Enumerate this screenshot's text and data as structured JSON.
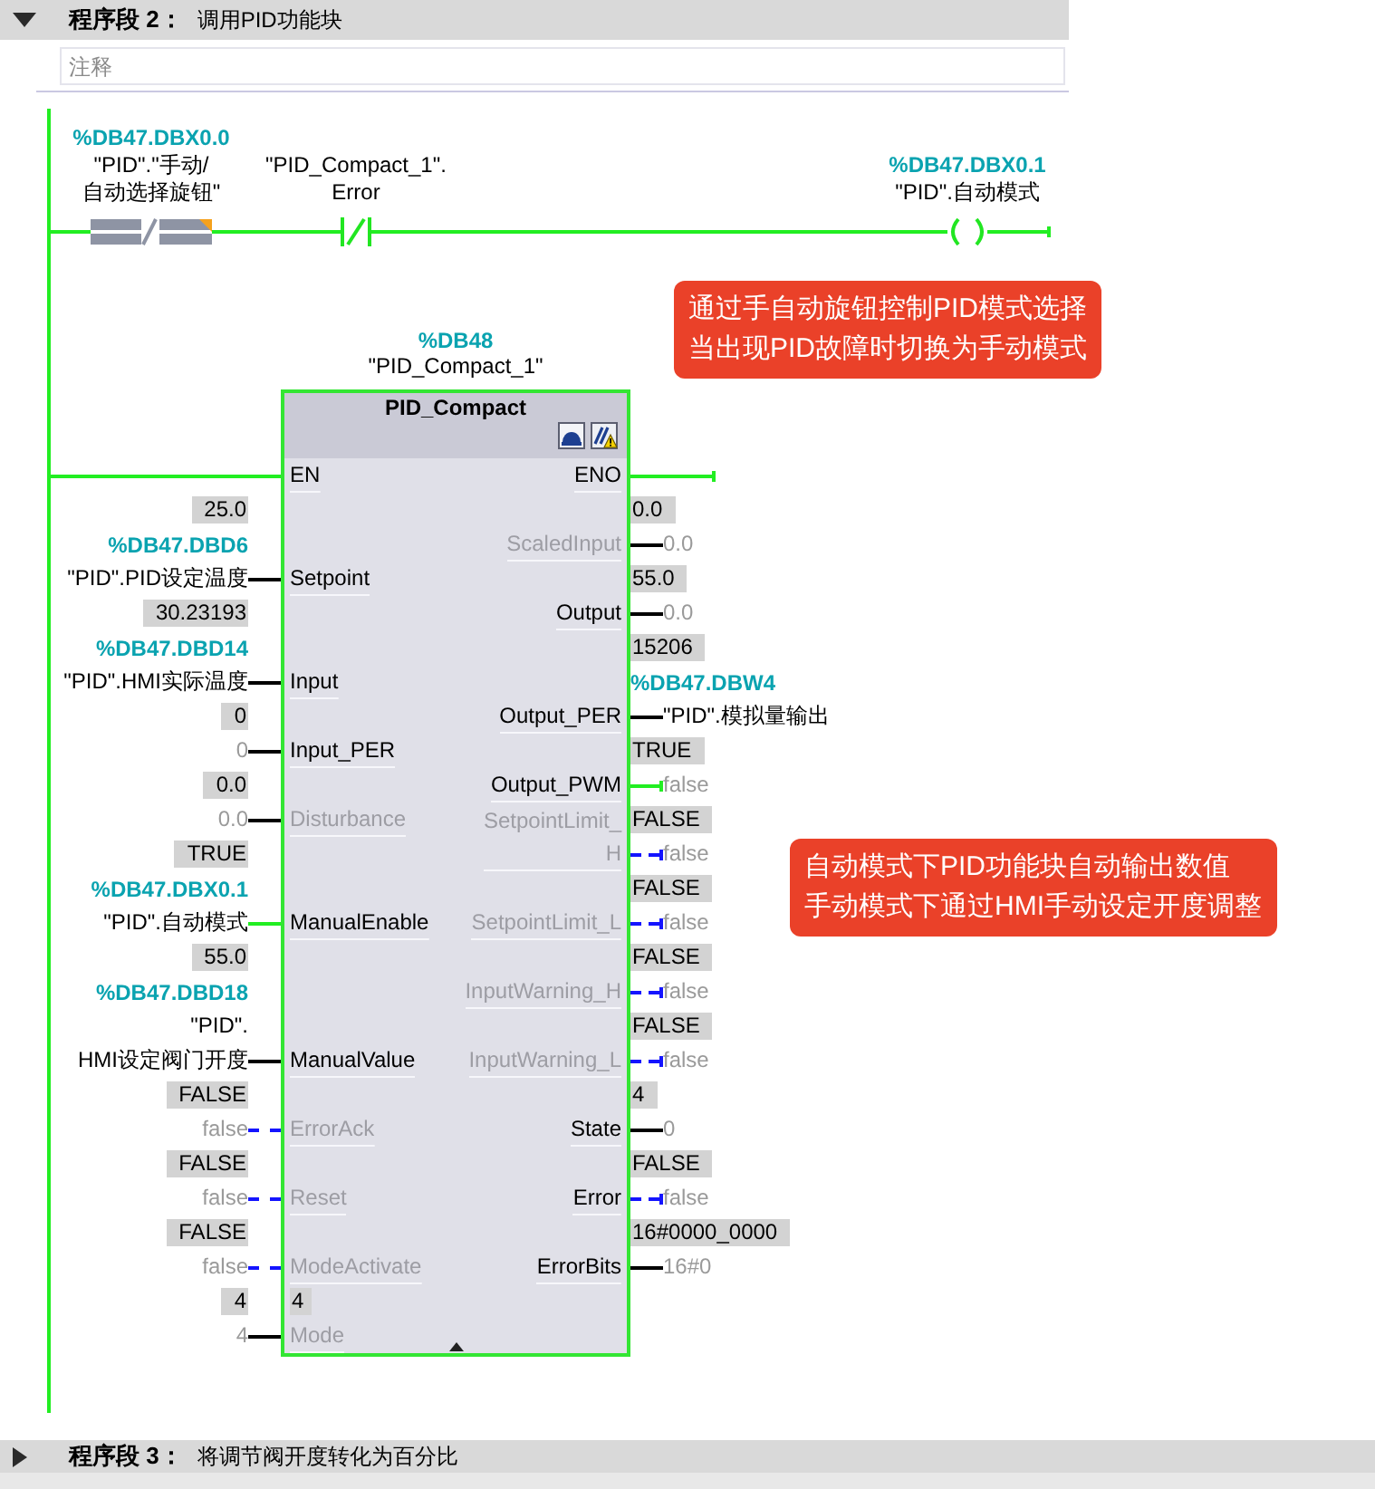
{
  "networks": [
    {
      "title": "程序段 2：",
      "caption": "调用PID功能块",
      "expanded": true,
      "comment": {
        "placeholder": "注释"
      },
      "rung": {
        "powered": true,
        "elements": [
          {
            "kind": "selector",
            "address": "%DB47.DBX0.0",
            "operand": "\"PID\".\"手动/\n自动选择旋钮\""
          },
          {
            "kind": "nc_contact",
            "operand": "\"PID_Compact_1\".\nError"
          },
          {
            "kind": "coil",
            "address": "%DB47.DBX0.1",
            "operand": "\"PID\".自动模式"
          }
        ]
      },
      "block": {
        "address": "%DB48",
        "instance": "\"PID_Compact_1\"",
        "type_name": "PID_Compact",
        "inputs": [
          {
            "name": "EN",
            "powered": true,
            "greyed": false
          },
          {
            "name": "Setpoint",
            "value": "25.0",
            "address": "%DB47.DBD6",
            "operand": "\"PID\".PID设定温度",
            "kind": "symbol",
            "greyed": false
          },
          {
            "name": "Input",
            "value": "30.23193",
            "address": "%DB47.DBD14",
            "operand": "\"PID\".HMI实际温度",
            "kind": "symbol",
            "greyed": false
          },
          {
            "name": "Input_PER",
            "value": "0",
            "operand": "0",
            "kind": "default",
            "greyed": false
          },
          {
            "name": "Disturbance",
            "value": "0.0",
            "operand": "0.0",
            "kind": "default",
            "greyed": true
          },
          {
            "name": "ManualEnable",
            "value": "TRUE",
            "address": "%DB47.DBX0.1",
            "operand": "\"PID\".自动模式",
            "kind": "symbol",
            "powered": true,
            "greyed": false
          },
          {
            "name": "ManualValue",
            "value": "55.0",
            "address": "%DB47.DBD18",
            "operand": "\"PID\".\nHMI设定阀门开度",
            "kind": "symbol",
            "greyed": false
          },
          {
            "name": "ErrorAck",
            "value": "FALSE",
            "operand": "false",
            "kind": "default",
            "powered": false,
            "greyed": true
          },
          {
            "name": "Reset",
            "value": "FALSE",
            "operand": "false",
            "kind": "default",
            "powered": false,
            "greyed": true
          },
          {
            "name": "ModeActivate",
            "value": "FALSE",
            "operand": "false",
            "kind": "default",
            "powered": false,
            "greyed": true
          },
          {
            "name": "Mode",
            "pin_value": "4",
            "value": "4",
            "operand": "4",
            "kind": "default",
            "greyed": true
          }
        ],
        "outputs": [
          {
            "name": "ENO",
            "powered": true,
            "greyed": false
          },
          {
            "name": "ScaledInput",
            "value": "0.0",
            "operand": "0.0",
            "kind": "default",
            "greyed": true
          },
          {
            "name": "Output",
            "value": "55.0",
            "operand": "0.0",
            "kind": "default",
            "greyed": false
          },
          {
            "name": "Output_PER",
            "value": "15206",
            "address": "%DB47.DBW4",
            "operand": "\"PID\".模拟量输出",
            "kind": "symbol",
            "greyed": false
          },
          {
            "name": "Output_PWM",
            "value": "TRUE",
            "operand": "false",
            "kind": "default",
            "powered": true,
            "greyed": false
          },
          {
            "name": "SetpointLimit_\nH",
            "value": "FALSE",
            "operand": "false",
            "kind": "default",
            "powered": false,
            "greyed": true
          },
          {
            "name": "SetpointLimit_L",
            "value": "FALSE",
            "operand": "false",
            "kind": "default",
            "powered": false,
            "greyed": true
          },
          {
            "name": "InputWarning_H",
            "value": "FALSE",
            "operand": "false",
            "kind": "default",
            "powered": false,
            "greyed": true
          },
          {
            "name": "InputWarning_L",
            "value": "FALSE",
            "operand": "false",
            "kind": "default",
            "powered": false,
            "greyed": true
          },
          {
            "name": "State",
            "value": "4",
            "operand": "0",
            "kind": "default",
            "greyed": false
          },
          {
            "name": "Error",
            "value": "FALSE",
            "operand": "false",
            "kind": "default",
            "powered": false,
            "greyed": false
          },
          {
            "name": "ErrorBits",
            "value": "16#0000_0000",
            "operand": "16#0",
            "kind": "default",
            "greyed": false
          }
        ]
      },
      "callouts": [
        {
          "lines": [
            "通过手自动旋钮控制PID模式选择",
            "当出现PID故障时切换为手动模式"
          ]
        },
        {
          "lines": [
            "自动模式下PID功能块自动输出数值",
            "手动模式下通过HMI手动设定开度调整"
          ]
        }
      ]
    },
    {
      "title": "程序段 3：",
      "caption": "将调节阀开度转化为百分比",
      "expanded": false
    }
  ]
}
